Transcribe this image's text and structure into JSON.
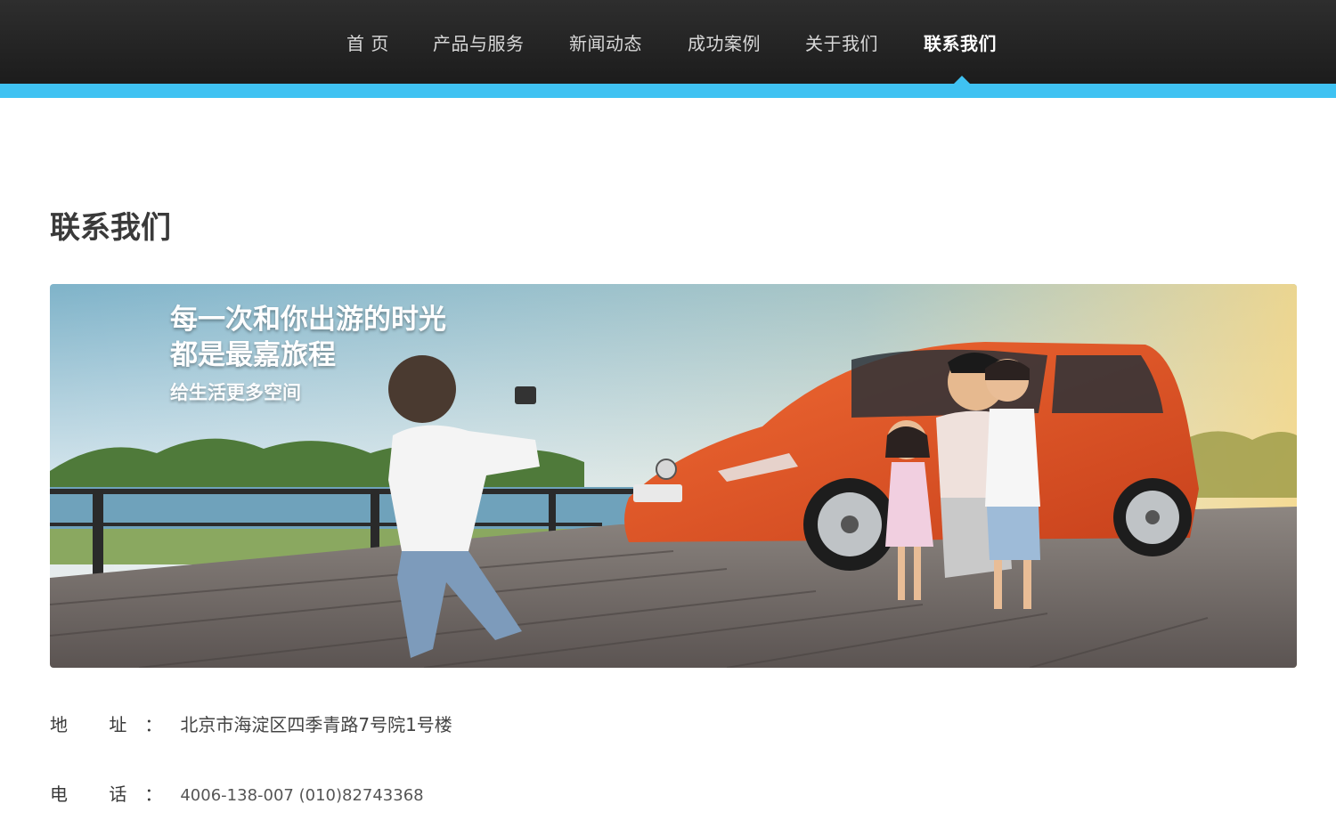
{
  "nav": {
    "items": [
      {
        "label": "首 页"
      },
      {
        "label": "产品与服务"
      },
      {
        "label": "新闻动态"
      },
      {
        "label": "成功案例"
      },
      {
        "label": "关于我们"
      },
      {
        "label": "联系我们"
      }
    ],
    "active_index": 5,
    "accent_color": "#3fc2f2"
  },
  "page": {
    "title": "联系我们"
  },
  "banner": {
    "line1": "每一次和你出游的时光",
    "line2": "都是最嘉旅程",
    "line3": "给生活更多空间"
  },
  "contact": {
    "address_label": "地 址：",
    "address_value": "北京市海淀区四季青路7号院1号楼",
    "phone_label": "电 话：",
    "phone_value": "4006-138-007 (010)82743368"
  }
}
